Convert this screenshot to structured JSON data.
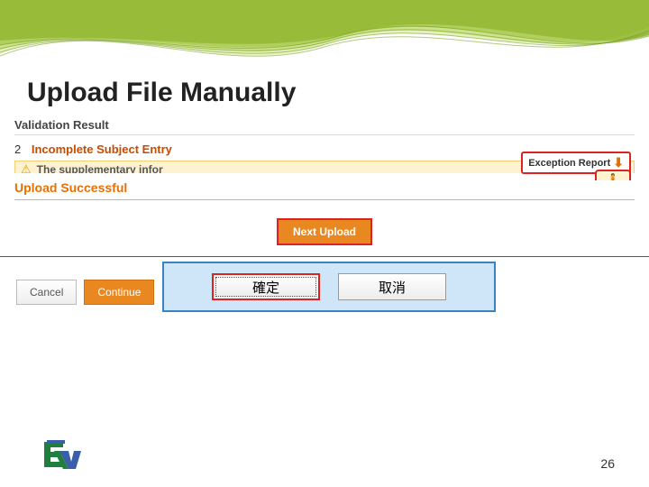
{
  "title": "Upload File Manually",
  "validation": {
    "label": "Validation Result"
  },
  "subject": {
    "count": "2",
    "text": "Incomplete Subject Entry"
  },
  "warning": {
    "text": "The supplementary infor"
  },
  "exception": {
    "label": "Exception Report"
  },
  "upload": {
    "success_label": "Upload Successful",
    "next_label": "Next Upload"
  },
  "actions": {
    "cancel": "Cancel",
    "continue": "Continue"
  },
  "dialog": {
    "confirm": "確定",
    "cancel": "取消"
  },
  "page_number": "26"
}
